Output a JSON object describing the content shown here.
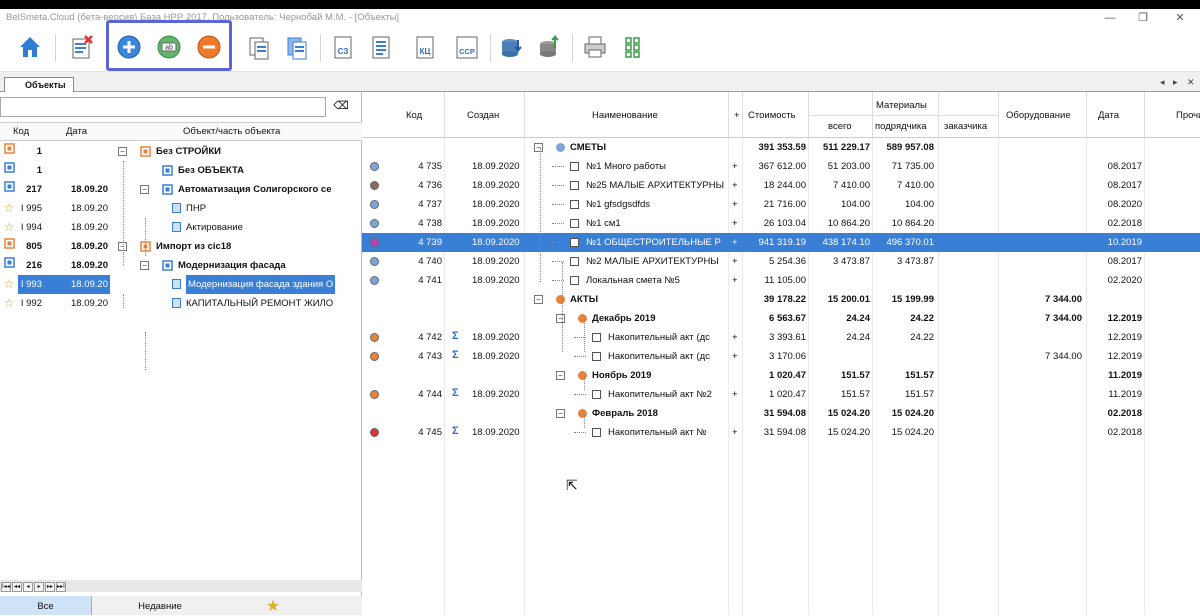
{
  "window": {
    "title": "BelSmeta.Cloud (бета-версия) База НРР 2017, Пользователь: Чернобай М.М. - [Объекты]",
    "min": "—",
    "restore": "❐",
    "close": "✕"
  },
  "toolbar": {
    "icons": [
      "home-icon",
      "delete-doc-icon",
      "add-icon",
      "rename-icon",
      "remove-icon",
      "copy-doc-icon",
      "copy-doc2-icon",
      "sc-report-icon",
      "list-doc-icon",
      "kc-report-icon",
      "ccp-report-icon",
      "import-icon",
      "export-icon",
      "print-icon",
      "grid-icon"
    ],
    "labels": {
      "sc": "СЗ",
      "kc": "КЦ",
      "ccp": "ССР",
      "rename": "ab"
    }
  },
  "tabs": {
    "active": "Объекты",
    "prev": "◂",
    "next": "▸",
    "close": "✕"
  },
  "left": {
    "clear_icon": "⌫",
    "headers": {
      "code": "Код",
      "date": "Дата",
      "object": "Объект/часть объекта"
    },
    "rows": [
      {
        "code": "1",
        "date": "",
        "name": "Без СТРОЙКИ",
        "bold": true
      },
      {
        "code": "1",
        "date": "",
        "name": "Без ОБЪЕКТА",
        "bold": true
      },
      {
        "code": "217",
        "date": "18.09.20",
        "name": "Автоматизация Солигорского се",
        "bold": true
      },
      {
        "code": "I 995",
        "date": "18.09.20",
        "name": "ПНР",
        "bold": false
      },
      {
        "code": "I 994",
        "date": "18.09.20",
        "name": "Актирование",
        "bold": false
      },
      {
        "code": "805",
        "date": "18.09.20",
        "name": "Импорт из cic18",
        "bold": true
      },
      {
        "code": "216",
        "date": "18.09.20",
        "name": "Модернизация фасада",
        "bold": true
      },
      {
        "code": "I 993",
        "date": "18.09.20",
        "name": "Модернизация фасада здания О",
        "bold": false
      },
      {
        "code": "I 992",
        "date": "18.09.20",
        "name": "КАПИТАЛЬНЫЙ РЕМОНТ ЖИЛО",
        "bold": false
      }
    ],
    "nav_buttons": [
      "I◂◂",
      "◂◂",
      "◂",
      "▸",
      "▸▸",
      "▸▸I"
    ],
    "bottom_tabs": [
      "Все",
      "Недавние"
    ]
  },
  "right": {
    "headers": {
      "code": "Код",
      "created": "Создан",
      "name": "Наименование",
      "plus": "+",
      "cost": "Стоимость",
      "materials": "Материалы",
      "mat_total": "всего",
      "mat_contractor": "подрядчика",
      "mat_customer": "заказчика",
      "equipment": "Оборудование",
      "date": "Дата",
      "other": "Прочие"
    },
    "rows": [
      {
        "level": 0,
        "group": true,
        "name": "СМЕТЫ",
        "code": "",
        "created": "",
        "cost": "391 353.59",
        "total": "511 229.17",
        "contr": "589 957.08",
        "equip": "",
        "date": ""
      },
      {
        "level": 1,
        "name": "№1 Много работы",
        "code": "4 735",
        "created": "18.09.2020",
        "cost": "367 612.00",
        "total": "51 203.00",
        "contr": "71 735.00",
        "equip": "",
        "date": "08.2017",
        "plus": "+"
      },
      {
        "level": 1,
        "name": "№25 МАЛЫЕ АРХИТЕКТУРНЫ",
        "code": "4 736",
        "created": "18.09.2020",
        "cost": "18 244.00",
        "total": "7 410.00",
        "contr": "7 410.00",
        "equip": "",
        "date": "08.2017",
        "plus": "+"
      },
      {
        "level": 1,
        "name": "№1 gfsdgsdfds",
        "code": "4 737",
        "created": "18.09.2020",
        "cost": "21 716.00",
        "total": "104.00",
        "contr": "104.00",
        "equip": "",
        "date": "08.2020",
        "plus": "+"
      },
      {
        "level": 1,
        "name": "№1 см1",
        "code": "4 738",
        "created": "18.09.2020",
        "cost": "26 103.04",
        "total": "10 864.20",
        "contr": "10 864.20",
        "equip": "",
        "date": "02.2018",
        "plus": "+"
      },
      {
        "level": 1,
        "name": "№1 ОБЩЕСТРОИТЕЛЬНЫЕ Р",
        "code": "4 739",
        "created": "18.09.2020",
        "cost": "941 319.19",
        "total": "438 174.10",
        "contr": "496 370.01",
        "equip": "",
        "date": "10.2019",
        "plus": "+",
        "selected": true
      },
      {
        "level": 1,
        "name": "№2 МАЛЫЕ АРХИТЕКТУРНЫ",
        "code": "4 740",
        "created": "18.09.2020",
        "cost": "5 254.36",
        "total": "3 473.87",
        "contr": "3 473.87",
        "equip": "",
        "date": "08.2017",
        "plus": "+"
      },
      {
        "level": 1,
        "name": "Локальная смета №5",
        "code": "4 741",
        "created": "18.09.2020",
        "cost": "11 105.00",
        "total": "",
        "contr": "",
        "equip": "",
        "date": "02.2020",
        "plus": "+"
      },
      {
        "level": 0,
        "group": true,
        "name": "АКТЫ",
        "code": "",
        "created": "",
        "cost": "39 178.22",
        "total": "15 200.01",
        "contr": "15 199.99",
        "equip": "7 344.00",
        "date": ""
      },
      {
        "level": 1,
        "group": true,
        "name": "Декабрь 2019",
        "code": "",
        "created": "",
        "cost": "6 563.67",
        "total": "24.24",
        "contr": "24.22",
        "equip": "7 344.00",
        "date": "12.2019"
      },
      {
        "level": 2,
        "name": "Накопительный акт (дс",
        "code": "4 742",
        "created": "18.09.2020",
        "cost": "3 393.61",
        "total": "24.24",
        "contr": "24.22",
        "equip": "",
        "date": "12.2019",
        "plus": "+",
        "sigma": true
      },
      {
        "level": 2,
        "name": "Накопительный акт (дс",
        "code": "4 743",
        "created": "18.09.2020",
        "cost": "3 170.06",
        "total": "",
        "contr": "",
        "equip": "7 344.00",
        "date": "12.2019",
        "plus": "+",
        "sigma": true
      },
      {
        "level": 1,
        "group": true,
        "name": "Ноябрь 2019",
        "code": "",
        "created": "",
        "cost": "1 020.47",
        "total": "151.57",
        "contr": "151.57",
        "equip": "",
        "date": "11.2019"
      },
      {
        "level": 2,
        "name": "Накопительный акт №2",
        "code": "4 744",
        "created": "18.09.2020",
        "cost": "1 020.47",
        "total": "151.57",
        "contr": "151.57",
        "equip": "",
        "date": "11.2019",
        "plus": "+",
        "sigma": true
      },
      {
        "level": 1,
        "group": true,
        "name": "Февраль 2018",
        "code": "",
        "created": "",
        "cost": "31 594.08",
        "total": "15 024.20",
        "contr": "15 024.20",
        "equip": "",
        "date": "02.2018"
      },
      {
        "level": 2,
        "name": "Накопительный акт №",
        "code": "4 745",
        "created": "18.09.2020",
        "cost": "31 594.08",
        "total": "15 024.20",
        "contr": "15 024.20",
        "equip": "",
        "date": "02.2018",
        "plus": "+",
        "sigma": true
      }
    ]
  },
  "colors": {
    "accent": "#3a7fd6",
    "highlight": "#5a66d8",
    "orange": "#e8843a",
    "blue": "#3a7fd6"
  }
}
